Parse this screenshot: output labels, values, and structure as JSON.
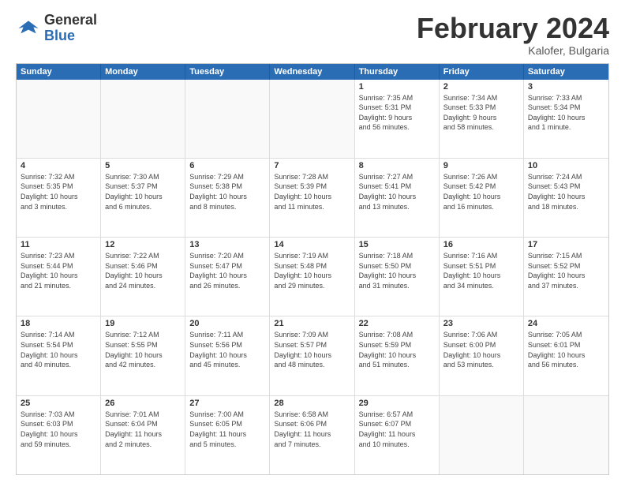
{
  "logo": {
    "general": "General",
    "blue": "Blue"
  },
  "title": "February 2024",
  "location": "Kalofer, Bulgaria",
  "weekdays": [
    "Sunday",
    "Monday",
    "Tuesday",
    "Wednesday",
    "Thursday",
    "Friday",
    "Saturday"
  ],
  "rows": [
    [
      {
        "day": "",
        "details": ""
      },
      {
        "day": "",
        "details": ""
      },
      {
        "day": "",
        "details": ""
      },
      {
        "day": "",
        "details": ""
      },
      {
        "day": "1",
        "details": "Sunrise: 7:35 AM\nSunset: 5:31 PM\nDaylight: 9 hours\nand 56 minutes."
      },
      {
        "day": "2",
        "details": "Sunrise: 7:34 AM\nSunset: 5:33 PM\nDaylight: 9 hours\nand 58 minutes."
      },
      {
        "day": "3",
        "details": "Sunrise: 7:33 AM\nSunset: 5:34 PM\nDaylight: 10 hours\nand 1 minute."
      }
    ],
    [
      {
        "day": "4",
        "details": "Sunrise: 7:32 AM\nSunset: 5:35 PM\nDaylight: 10 hours\nand 3 minutes."
      },
      {
        "day": "5",
        "details": "Sunrise: 7:30 AM\nSunset: 5:37 PM\nDaylight: 10 hours\nand 6 minutes."
      },
      {
        "day": "6",
        "details": "Sunrise: 7:29 AM\nSunset: 5:38 PM\nDaylight: 10 hours\nand 8 minutes."
      },
      {
        "day": "7",
        "details": "Sunrise: 7:28 AM\nSunset: 5:39 PM\nDaylight: 10 hours\nand 11 minutes."
      },
      {
        "day": "8",
        "details": "Sunrise: 7:27 AM\nSunset: 5:41 PM\nDaylight: 10 hours\nand 13 minutes."
      },
      {
        "day": "9",
        "details": "Sunrise: 7:26 AM\nSunset: 5:42 PM\nDaylight: 10 hours\nand 16 minutes."
      },
      {
        "day": "10",
        "details": "Sunrise: 7:24 AM\nSunset: 5:43 PM\nDaylight: 10 hours\nand 18 minutes."
      }
    ],
    [
      {
        "day": "11",
        "details": "Sunrise: 7:23 AM\nSunset: 5:44 PM\nDaylight: 10 hours\nand 21 minutes."
      },
      {
        "day": "12",
        "details": "Sunrise: 7:22 AM\nSunset: 5:46 PM\nDaylight: 10 hours\nand 24 minutes."
      },
      {
        "day": "13",
        "details": "Sunrise: 7:20 AM\nSunset: 5:47 PM\nDaylight: 10 hours\nand 26 minutes."
      },
      {
        "day": "14",
        "details": "Sunrise: 7:19 AM\nSunset: 5:48 PM\nDaylight: 10 hours\nand 29 minutes."
      },
      {
        "day": "15",
        "details": "Sunrise: 7:18 AM\nSunset: 5:50 PM\nDaylight: 10 hours\nand 31 minutes."
      },
      {
        "day": "16",
        "details": "Sunrise: 7:16 AM\nSunset: 5:51 PM\nDaylight: 10 hours\nand 34 minutes."
      },
      {
        "day": "17",
        "details": "Sunrise: 7:15 AM\nSunset: 5:52 PM\nDaylight: 10 hours\nand 37 minutes."
      }
    ],
    [
      {
        "day": "18",
        "details": "Sunrise: 7:14 AM\nSunset: 5:54 PM\nDaylight: 10 hours\nand 40 minutes."
      },
      {
        "day": "19",
        "details": "Sunrise: 7:12 AM\nSunset: 5:55 PM\nDaylight: 10 hours\nand 42 minutes."
      },
      {
        "day": "20",
        "details": "Sunrise: 7:11 AM\nSunset: 5:56 PM\nDaylight: 10 hours\nand 45 minutes."
      },
      {
        "day": "21",
        "details": "Sunrise: 7:09 AM\nSunset: 5:57 PM\nDaylight: 10 hours\nand 48 minutes."
      },
      {
        "day": "22",
        "details": "Sunrise: 7:08 AM\nSunset: 5:59 PM\nDaylight: 10 hours\nand 51 minutes."
      },
      {
        "day": "23",
        "details": "Sunrise: 7:06 AM\nSunset: 6:00 PM\nDaylight: 10 hours\nand 53 minutes."
      },
      {
        "day": "24",
        "details": "Sunrise: 7:05 AM\nSunset: 6:01 PM\nDaylight: 10 hours\nand 56 minutes."
      }
    ],
    [
      {
        "day": "25",
        "details": "Sunrise: 7:03 AM\nSunset: 6:03 PM\nDaylight: 10 hours\nand 59 minutes."
      },
      {
        "day": "26",
        "details": "Sunrise: 7:01 AM\nSunset: 6:04 PM\nDaylight: 11 hours\nand 2 minutes."
      },
      {
        "day": "27",
        "details": "Sunrise: 7:00 AM\nSunset: 6:05 PM\nDaylight: 11 hours\nand 5 minutes."
      },
      {
        "day": "28",
        "details": "Sunrise: 6:58 AM\nSunset: 6:06 PM\nDaylight: 11 hours\nand 7 minutes."
      },
      {
        "day": "29",
        "details": "Sunrise: 6:57 AM\nSunset: 6:07 PM\nDaylight: 11 hours\nand 10 minutes."
      },
      {
        "day": "",
        "details": ""
      },
      {
        "day": "",
        "details": ""
      }
    ]
  ]
}
